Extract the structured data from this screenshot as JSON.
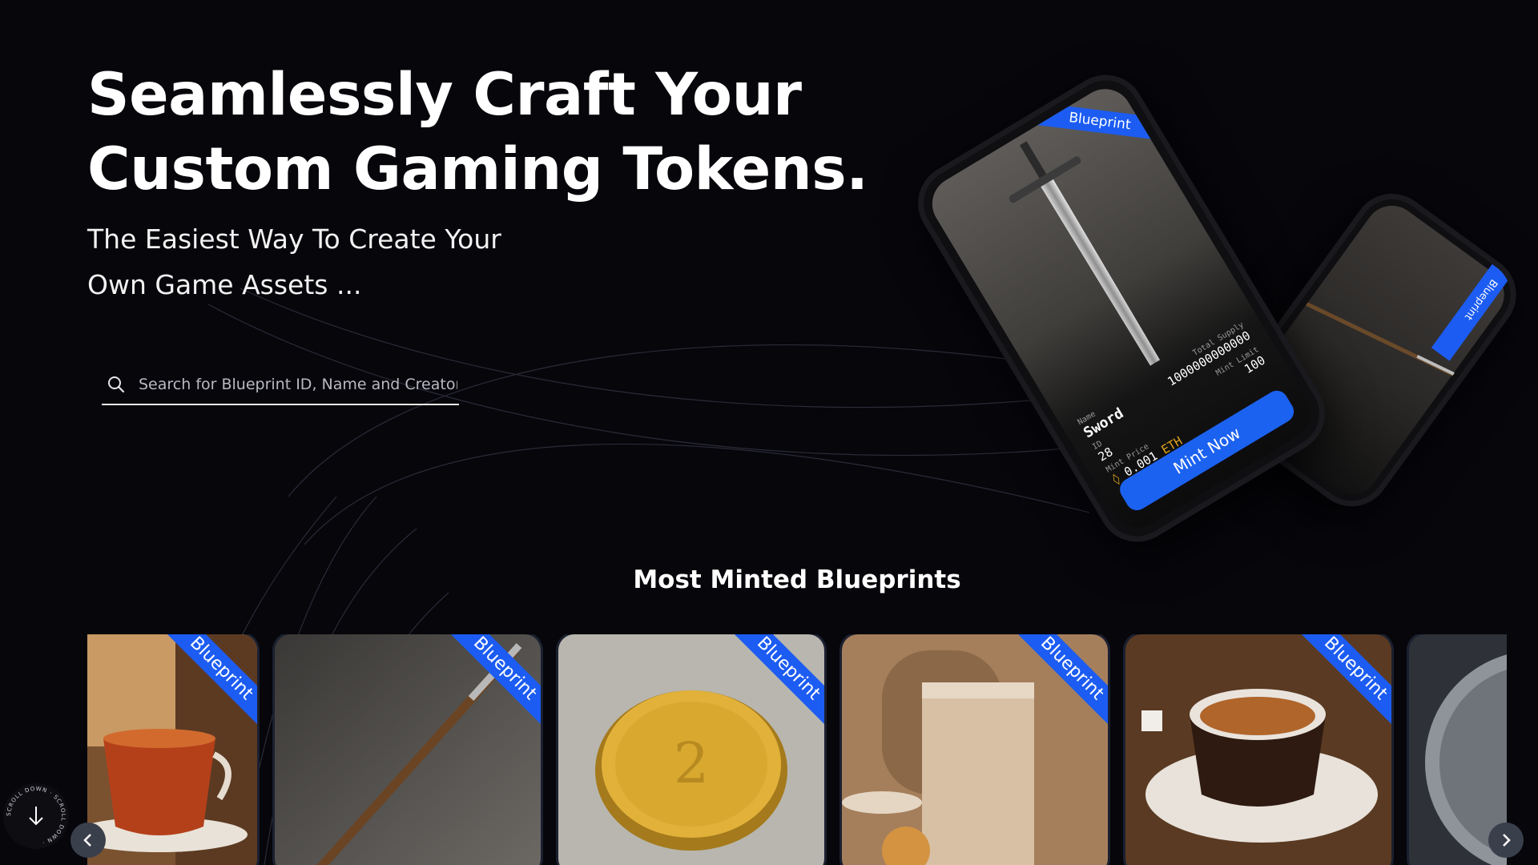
{
  "hero": {
    "title_line1": "Seamlessly Craft Your",
    "title_line2": "Custom Gaming Tokens.",
    "subtitle_line1": "The Easiest Way To Create Your",
    "subtitle_line2": "Own Game Assets ..."
  },
  "search": {
    "placeholder": "Search for Blueprint ID, Name and Creator",
    "value": ""
  },
  "featured_card": {
    "ribbon": "Blueprint",
    "name_label": "Name",
    "name": "Sword",
    "supply_label": "Total Supply",
    "supply": "1000000000000",
    "id_label": "ID",
    "id": "28",
    "limit_label": "Mint Limit",
    "limit": "100",
    "price_label": "Mint Price",
    "price": "0.001",
    "price_unit": "ETH",
    "mint_button": "Mint Now"
  },
  "back_card": {
    "ribbon": "Blueprint"
  },
  "section": {
    "title": "Most Minted Blueprints"
  },
  "cards": [
    {
      "ribbon": "Blueprint",
      "image": "tea-cup"
    },
    {
      "ribbon": "Blueprint",
      "image": "quill-pen"
    },
    {
      "ribbon": "Blueprint",
      "image": "gold-coin"
    },
    {
      "ribbon": "Blueprint",
      "image": "milk-tea-glass"
    },
    {
      "ribbon": "Blueprint",
      "image": "coffee-cup"
    },
    {
      "ribbon": "",
      "image": "silver-coin"
    }
  ],
  "icons": {
    "search": "search-icon",
    "prev": "chevron-left-icon",
    "next": "chevron-right-icon",
    "scroll": "arrow-down-icon"
  },
  "scroll_badge": {
    "text": "SCROLL DOWN · SCROLL DOWN ·"
  },
  "colors": {
    "background": "#06060b",
    "accent": "#1c5cf2",
    "eth": "#e0a31a"
  }
}
